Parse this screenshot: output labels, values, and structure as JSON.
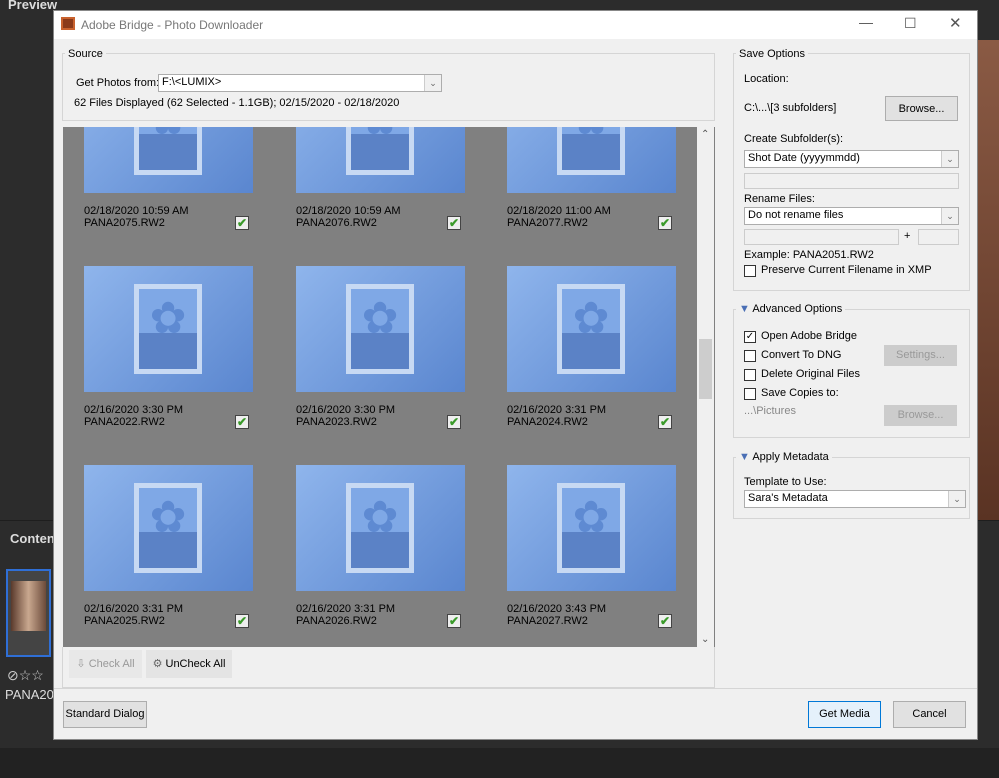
{
  "background": {
    "preview_label": "Preview",
    "content_label": "Conten",
    "thumb_name": "PANA20"
  },
  "dialog": {
    "title": "Adobe Bridge - Photo Downloader"
  },
  "source": {
    "label": "Source",
    "get_from_label": "Get Photos from:",
    "get_from_value": "F:\\<LUMIX>",
    "summary": "62 Files Displayed (62 Selected - 1.1GB); 02/15/2020 - 02/18/2020"
  },
  "photos": [
    {
      "date": "02/18/2020 10:59 AM",
      "name": "PANA2075.RW2",
      "checked": true
    },
    {
      "date": "02/18/2020 10:59 AM",
      "name": "PANA2076.RW2",
      "checked": true
    },
    {
      "date": "02/18/2020 11:00 AM",
      "name": "PANA2077.RW2",
      "checked": true
    },
    {
      "date": "02/16/2020 3:30 PM",
      "name": "PANA2022.RW2",
      "checked": true
    },
    {
      "date": "02/16/2020 3:30 PM",
      "name": "PANA2023.RW2",
      "checked": true
    },
    {
      "date": "02/16/2020 3:31 PM",
      "name": "PANA2024.RW2",
      "checked": true
    },
    {
      "date": "02/16/2020 3:31 PM",
      "name": "PANA2025.RW2",
      "checked": true
    },
    {
      "date": "02/16/2020 3:31 PM",
      "name": "PANA2026.RW2",
      "checked": true
    },
    {
      "date": "02/16/2020 3:43 PM",
      "name": "PANA2027.RW2",
      "checked": true
    }
  ],
  "grid_buttons": {
    "check_all": "Check All",
    "uncheck_all": "UnCheck All"
  },
  "save_options": {
    "label": "Save Options",
    "location_label": "Location:",
    "location_value": "C:\\...\\[3 subfolders]",
    "browse": "Browse...",
    "subfolder_label": "Create Subfolder(s):",
    "subfolder_value": "Shot Date (yyyymmdd)",
    "rename_label": "Rename Files:",
    "rename_value": "Do not rename files",
    "plus": "+",
    "example": "Example:  PANA2051.RW2",
    "preserve": "Preserve Current Filename in XMP"
  },
  "advanced": {
    "label": "Advanced Options",
    "open_bridge": "Open Adobe Bridge",
    "convert_dng": "Convert To DNG",
    "settings": "Settings...",
    "delete_originals": "Delete Original Files",
    "save_copies": "Save Copies to:",
    "copies_path": "...\\Pictures",
    "browse": "Browse..."
  },
  "metadata": {
    "label": "Apply Metadata",
    "template_label": "Template to Use:",
    "template_value": "Sara's Metadata"
  },
  "footer": {
    "standard_dialog": "Standard Dialog",
    "get_media": "Get Media",
    "cancel": "Cancel"
  }
}
